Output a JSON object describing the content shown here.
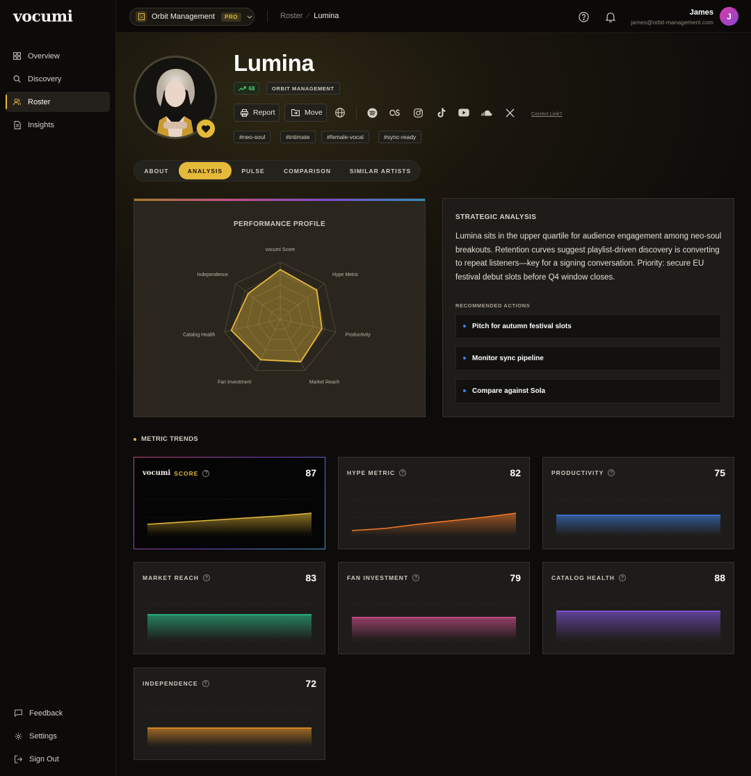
{
  "brand": {
    "logo": "vocumi"
  },
  "sidebar": {
    "items": [
      {
        "label": "Overview",
        "icon": "grid-icon"
      },
      {
        "label": "Discovery",
        "icon": "search-icon"
      },
      {
        "label": "Roster",
        "icon": "users-icon",
        "active": true
      },
      {
        "label": "Insights",
        "icon": "document-icon"
      }
    ],
    "bottom": [
      {
        "label": "Feedback",
        "icon": "chat-icon"
      },
      {
        "label": "Settings",
        "icon": "gear-icon"
      },
      {
        "label": "Sign Out",
        "icon": "sign-out-icon"
      }
    ]
  },
  "topbar": {
    "org": "Orbit Management",
    "badge": "PRO",
    "breadcrumb": [
      "Roster",
      "Lumina"
    ],
    "user_name": "James",
    "user_email": "james@orbit-management.com",
    "avatar_initial": "J"
  },
  "artist": {
    "name": "Lumina",
    "trend": "68",
    "org_tag": "ORBIT MANAGEMENT",
    "actions": {
      "report": "Report",
      "move": "Move"
    },
    "correct_link": "Correct Link?",
    "tags": [
      "#neo-soul",
      "#intimate",
      "#female-vocal",
      "#sync-ready"
    ]
  },
  "tabs": [
    "ABOUT",
    "ANALYSIS",
    "PULSE",
    "COMPARISON",
    "SIMILAR ARTISTS"
  ],
  "active_tab": "ANALYSIS",
  "performance": {
    "title": "PERFORMANCE PROFILE"
  },
  "chart_data": {
    "type": "radar",
    "title": "PERFORMANCE PROFILE",
    "categories": [
      "vocumi Score",
      "Hype Metric",
      "Productivity",
      "Market Reach",
      "Fan Investment",
      "Catalog Health",
      "Independence"
    ],
    "values": [
      87,
      82,
      75,
      83,
      79,
      88,
      72
    ],
    "range": [
      0,
      100
    ],
    "accent": "#e5b93a"
  },
  "strategic": {
    "title": "STRATEGIC ANALYSIS",
    "body": "Lumina sits in the upper quartile for audience engagement among neo-soul breakouts. Retention curves suggest playlist-driven discovery is converting to repeat listeners—key for a signing conversation. Priority: secure EU festival debut slots before Q4 window closes.",
    "rec_title": "RECOMMENDED ACTIONS",
    "actions": [
      "Pitch for autumn festival slots",
      "Monitor sync pipeline",
      "Compare against Sola"
    ]
  },
  "metric_trends": {
    "heading": "METRIC TRENDS",
    "cards": [
      {
        "label_logo": "vocumi",
        "label": "SCORE",
        "value": "87",
        "color": "#e5b93a",
        "trend": [
          0.62,
          0.65,
          0.68,
          0.71,
          0.74,
          0.78
        ]
      },
      {
        "label": "HYPE METRIC",
        "value": "82",
        "color": "#f07a2a",
        "trend": [
          0.53,
          0.56,
          0.62,
          0.67,
          0.72,
          0.78
        ]
      },
      {
        "label": "PRODUCTIVITY",
        "value": "75",
        "color": "#3f7ee6",
        "trend": [
          0.75,
          0.75,
          0.75,
          0.75,
          0.75,
          0.75
        ]
      },
      {
        "label": "MARKET REACH",
        "value": "83",
        "color": "#2bc48a",
        "trend": [
          0.83,
          0.83,
          0.83,
          0.83,
          0.83,
          0.83
        ]
      },
      {
        "label": "FAN INVESTMENT",
        "value": "79",
        "color": "#e05597",
        "trend": [
          0.79,
          0.79,
          0.79,
          0.79,
          0.79,
          0.79
        ]
      },
      {
        "label": "CATALOG HEALTH",
        "value": "88",
        "color": "#8b5ce8",
        "trend": [
          0.88,
          0.88,
          0.88,
          0.88,
          0.88,
          0.88
        ]
      },
      {
        "label": "INDEPENDENCE",
        "value": "72",
        "color": "#f29a2a",
        "trend": [
          0.72,
          0.72,
          0.72,
          0.72,
          0.72,
          0.72
        ]
      }
    ]
  }
}
